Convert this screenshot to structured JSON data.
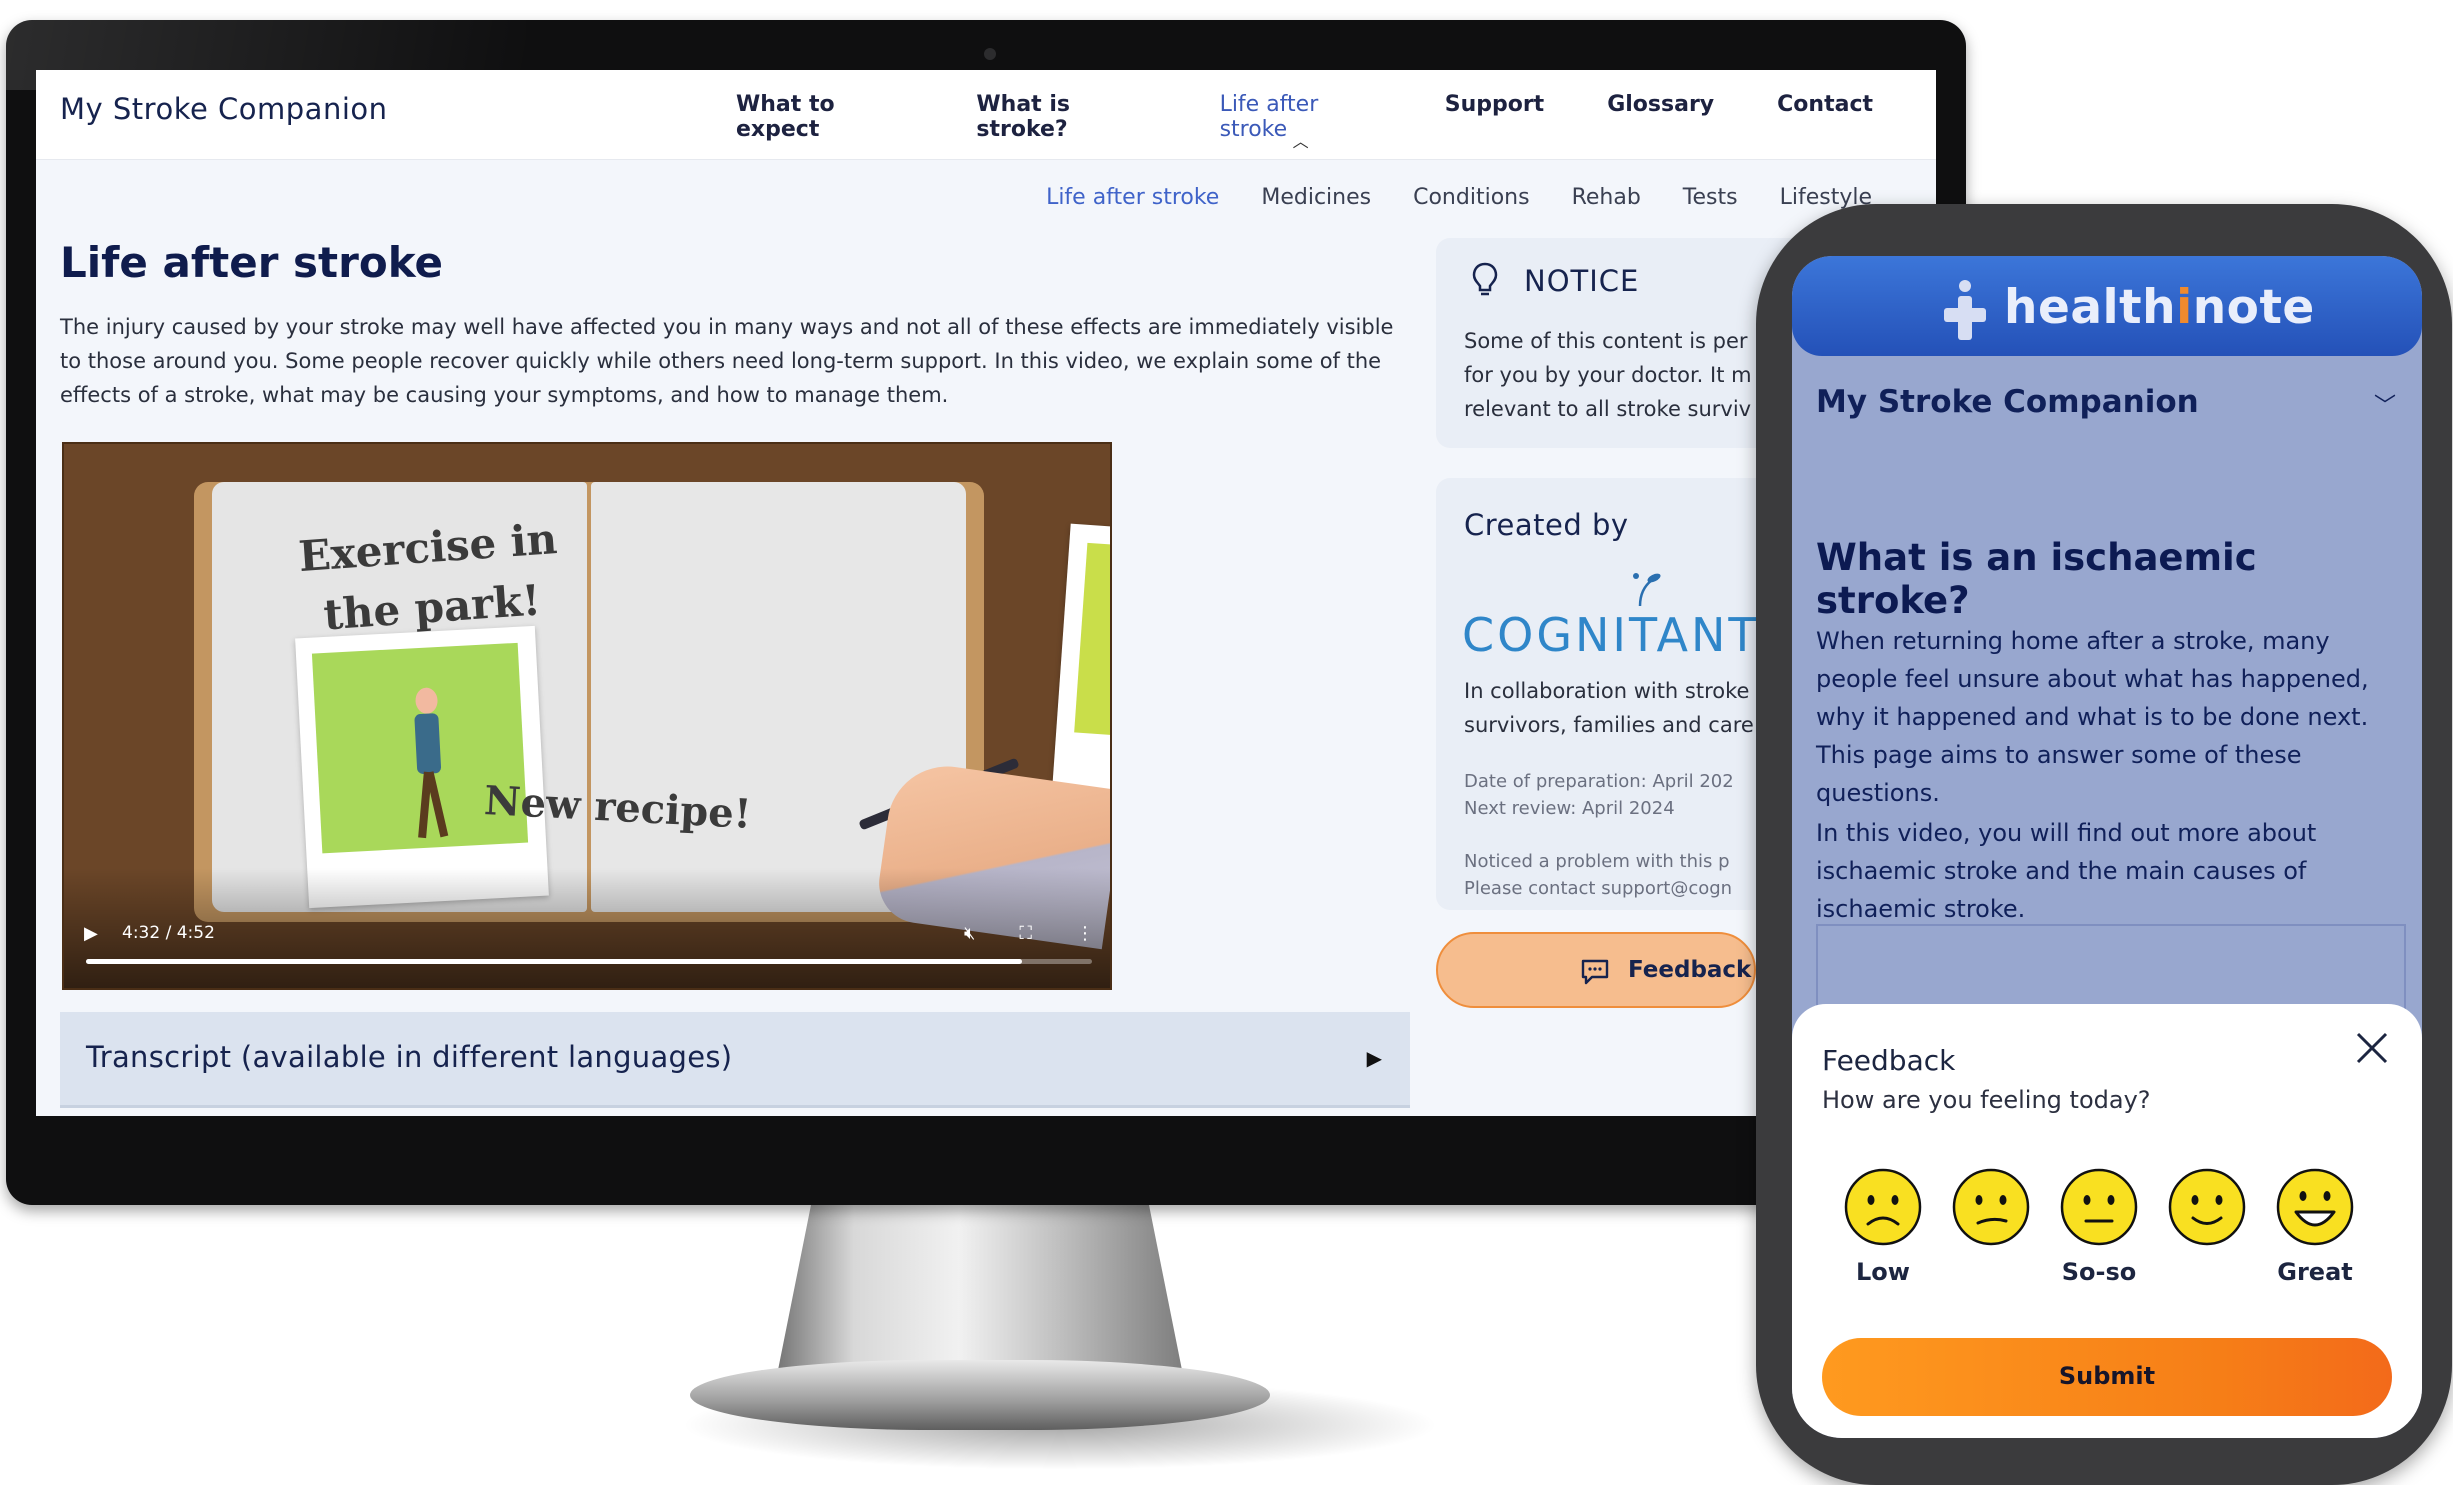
{
  "desktop": {
    "site_title": "My Stroke Companion",
    "main_nav": [
      {
        "label": "What to expect",
        "active": false
      },
      {
        "label": "What is stroke?",
        "active": false
      },
      {
        "label": "Life after stroke",
        "active": true
      },
      {
        "label": "Support",
        "active": false
      },
      {
        "label": "Glossary",
        "active": false
      },
      {
        "label": "Contact",
        "active": false
      }
    ],
    "sub_nav": [
      {
        "label": "Life after stroke",
        "active": true
      },
      {
        "label": "Medicines",
        "active": false
      },
      {
        "label": "Conditions",
        "active": false
      },
      {
        "label": "Rehab",
        "active": false
      },
      {
        "label": "Tests",
        "active": false
      },
      {
        "label": "Lifestyle",
        "active": false
      }
    ],
    "page_title": "Life after stroke",
    "intro": "The injury caused by your stroke may well have affected you in many ways and not all of these effects are immediately visible to those around you. Some people recover quickly while others need long-term support. In this video, we explain some of the effects of a stroke, what may be causing your symptoms, and how to manage them.",
    "video": {
      "scene_text_1": "Exercise in the park!",
      "scene_text_2": "New recipe!",
      "time": "4:32 / 4:52",
      "progress": 0.93
    },
    "transcript_label": "Transcript (available in different languages)",
    "notice": {
      "title": "NOTICE",
      "text": "Some of this content is per for you by your doctor. It m relevant to all stroke surviv"
    },
    "created": {
      "title": "Created by",
      "logo_text": "COGNITANT",
      "collab": "In collaboration with stroke survivors, families and care",
      "date_prep": "Date of preparation: April 202",
      "next_review": "Next review: April 2024",
      "problem_1": "Noticed a problem with this p",
      "problem_2": "Please contact support@cogn"
    },
    "feedback_label": "Feedback"
  },
  "phone": {
    "brand_a": "health",
    "brand_i": "i",
    "brand_b": "note",
    "app_title": "My Stroke Companion",
    "heading": "What is an ischaemic stroke?",
    "p1": "When returning home after a stroke, many people feel unsure about what has happened, why it happened and what is to be done next. This page aims to answer some of these questions.",
    "p2": "In this video, you will find out more about ischaemic stroke and the main causes of ischaemic stroke.",
    "feedback": {
      "title": "Feedback",
      "question": "How are you feeling today?",
      "faces": [
        "very-sad-face-icon",
        "sad-face-icon",
        "neutral-face-icon",
        "smile-face-icon",
        "grin-face-icon"
      ],
      "label_low": "Low",
      "label_mid": "So-so",
      "label_high": "Great",
      "submit": "Submit"
    }
  },
  "colors": {
    "brand_navy": "#16234e",
    "accent_blue": "#3b59b8",
    "feedback_orange": "#f6bd8e",
    "submit_orange": "#ff9a1f",
    "phone_bg": "#98a7cf",
    "face_yellow": "#f9e021"
  }
}
